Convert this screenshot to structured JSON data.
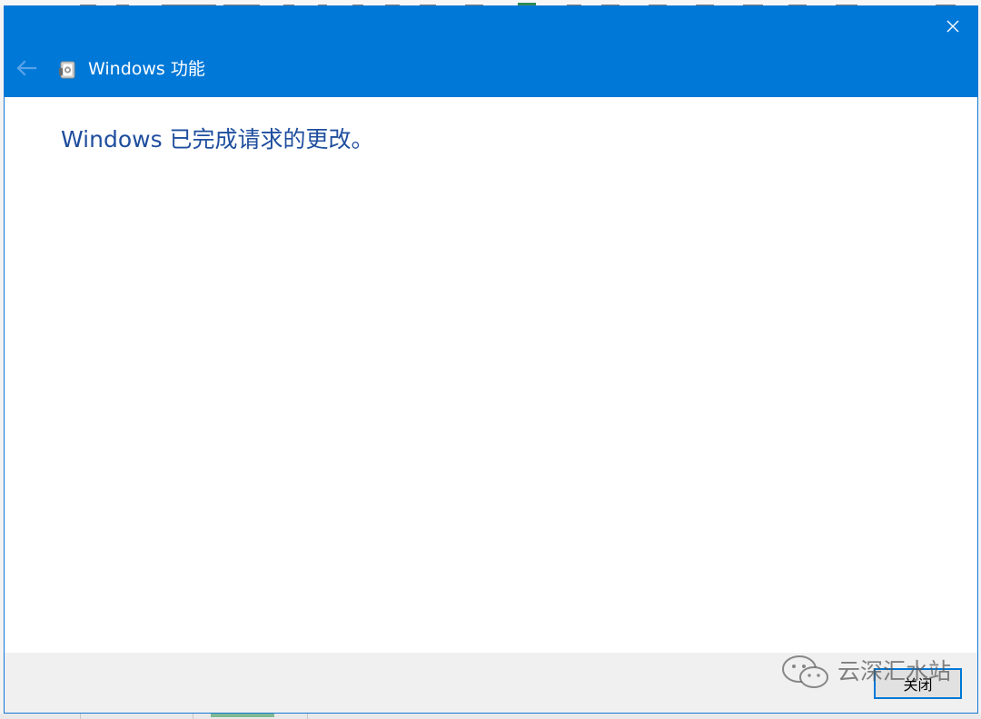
{
  "window": {
    "title": "Windows 功能",
    "titlebar_color": "#0078d7",
    "close_icon": "close-icon",
    "back_icon": "back-arrow-icon",
    "app_icon": "windows-features-icon"
  },
  "main": {
    "message": "Windows 已完成请求的更改。",
    "message_color": "#1f4e9e"
  },
  "footer": {
    "close_button_label": "关闭"
  },
  "watermark": {
    "text": "云深汇水站",
    "icon": "wechat-icon"
  }
}
